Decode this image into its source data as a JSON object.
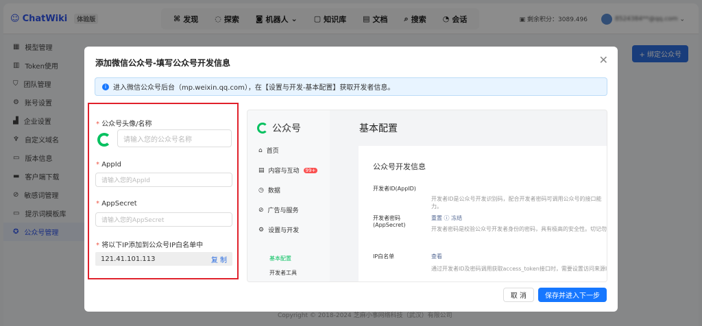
{
  "header": {
    "brand": "ChatWiki",
    "edition": "体验版",
    "nav": [
      {
        "label": "发现",
        "icon": "discover-icon"
      },
      {
        "label": "探索",
        "icon": "explore-icon"
      },
      {
        "label": "机器人",
        "icon": "robot-icon"
      },
      {
        "label": "知识库",
        "icon": "book-icon"
      },
      {
        "label": "文档",
        "icon": "doc-icon"
      },
      {
        "label": "搜索",
        "icon": "search-icon"
      },
      {
        "label": "会话",
        "icon": "chat-icon"
      }
    ],
    "points": "剩余积分：3089.496",
    "user": "8524384**@qq.com"
  },
  "sidebar": {
    "items": [
      "模型管理",
      "Token使用",
      "团队管理",
      "账号设置",
      "企业设置",
      "自定义域名",
      "版本信息",
      "客户端下载",
      "敏感词管理",
      "提示词模板库",
      "公众号管理"
    ],
    "active": 10
  },
  "bind_button": "+ 绑定公众号",
  "footer": "Copyright © 2018-2024 芝麻小事网络科技（武汉）有限公司",
  "modal": {
    "title": "添加微信公众号-填写公众号开发信息",
    "alert": "进入微信公众号后台（mp.weixin.qq.com），在【设置与开发-基本配置】获取开发者信息。",
    "form": {
      "name_label": "公众号头像/名称",
      "name_placeholder": "请输入您的公众号名称",
      "appid_label": "AppId",
      "appid_placeholder": "请输入您的AppId",
      "secret_label": "AppSecret",
      "secret_placeholder": "请输入您的AppSecret",
      "ip_label": "将以下IP添加到公众号IP白名单中",
      "ip": "121.41.101.113",
      "copy": "复 制"
    },
    "preview": {
      "brand": "公众号",
      "menu": [
        "首页",
        "内容与互动",
        "数据",
        "广告与服务",
        "设置与开发"
      ],
      "badge": "99+",
      "submenu": [
        "基本配置",
        "开发者工具"
      ],
      "title": "基本配置",
      "card_title": "公众号开发信息",
      "appid_label": "开发者ID(AppID)",
      "appid_desc": "开发者ID是公众号开发识别码，配合开发者密码可调用公众号的接口能力。",
      "secret_label": "开发者密码(AppSecret)",
      "reset": "重置",
      "freeze": "冻结",
      "secret_desc": "开发者密码是校验公众号开发者身份的密码，具有极高的安全性。切记勿把密码",
      "ip_label": "IP白名单",
      "view": "查看",
      "ip_desc": "通过开发者ID及密码调用获取access_token接口时，需要设置访问来源IP为白"
    },
    "cancel": "取 消",
    "save": "保存并进入下一步"
  },
  "colors": {
    "primary": "#1677ff",
    "highlight": "#e0202a",
    "wechat_green": "#07c160"
  }
}
